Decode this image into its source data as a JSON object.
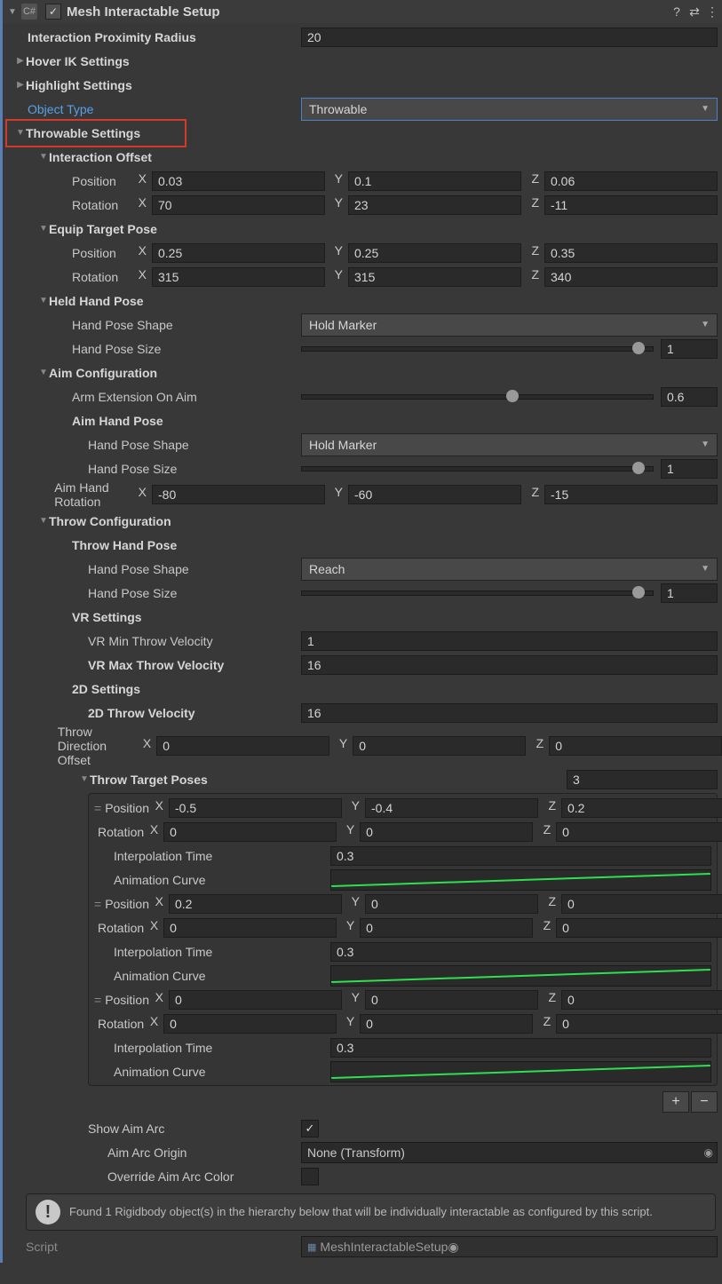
{
  "header": {
    "title": "Mesh Interactable Setup",
    "enabled": true
  },
  "proximity": {
    "label": "Interaction Proximity Radius",
    "value": "20"
  },
  "hoverIK": {
    "label": "Hover IK Settings"
  },
  "highlight": {
    "label": "Highlight Settings"
  },
  "objectType": {
    "label": "Object Type",
    "value": "Throwable"
  },
  "throwable": {
    "header": "Throwable Settings"
  },
  "interactionOffset": {
    "header": "Interaction Offset",
    "position": {
      "label": "Position",
      "x": "0.03",
      "y": "0.1",
      "z": "0.06"
    },
    "rotation": {
      "label": "Rotation",
      "x": "70",
      "y": "23",
      "z": "-11"
    }
  },
  "equipTarget": {
    "header": "Equip Target Pose",
    "position": {
      "label": "Position",
      "x": "0.25",
      "y": "0.25",
      "z": "0.35"
    },
    "rotation": {
      "label": "Rotation",
      "x": "315",
      "y": "315",
      "z": "340"
    }
  },
  "heldHand": {
    "header": "Held Hand Pose",
    "shape": {
      "label": "Hand Pose Shape",
      "value": "Hold Marker"
    },
    "size": {
      "label": "Hand Pose Size",
      "value": "1",
      "pct": 96
    }
  },
  "aim": {
    "header": "Aim Configuration",
    "armExt": {
      "label": "Arm Extension On Aim",
      "value": "0.6",
      "pct": 60
    },
    "poseHeader": "Aim Hand Pose",
    "shape": {
      "label": "Hand Pose Shape",
      "value": "Hold Marker"
    },
    "size": {
      "label": "Hand Pose Size",
      "value": "1",
      "pct": 96
    },
    "rot": {
      "label": "Aim Hand Rotation",
      "x": "-80",
      "y": "-60",
      "z": "-15"
    }
  },
  "throw": {
    "header": "Throw Configuration",
    "poseHeader": "Throw Hand Pose",
    "shape": {
      "label": "Hand Pose Shape",
      "value": "Reach"
    },
    "size": {
      "label": "Hand Pose Size",
      "value": "1",
      "pct": 96
    },
    "vrHeader": "VR Settings",
    "vrMin": {
      "label": "VR Min Throw Velocity",
      "value": "1"
    },
    "vrMax": {
      "label": "VR Max Throw Velocity",
      "value": "16"
    },
    "d2Header": "2D Settings",
    "d2Vel": {
      "label": "2D Throw Velocity",
      "value": "16"
    },
    "dirOff": {
      "label": "Throw Direction Offset",
      "x": "0",
      "y": "0",
      "z": "0"
    },
    "targetsHeader": "Throw Target Poses",
    "targetsCount": "3",
    "targets": [
      {
        "pos": {
          "x": "-0.5",
          "y": "-0.4",
          "z": "0.2"
        },
        "rot": {
          "x": "0",
          "y": "0",
          "z": "0"
        },
        "interp": "0.3"
      },
      {
        "pos": {
          "x": "0.2",
          "y": "0",
          "z": "0"
        },
        "rot": {
          "x": "0",
          "y": "0",
          "z": "0"
        },
        "interp": "0.3"
      },
      {
        "pos": {
          "x": "0",
          "y": "0",
          "z": "0"
        },
        "rot": {
          "x": "0",
          "y": "0",
          "z": "0"
        },
        "interp": "0.3"
      }
    ],
    "posLabel": "Position",
    "rotLabel": "Rotation",
    "interpLabel": "Interpolation Time",
    "curveLabel": "Animation Curve"
  },
  "showAimArc": {
    "label": "Show Aim Arc",
    "checked": true
  },
  "aimArcOrigin": {
    "label": "Aim Arc Origin",
    "value": "None (Transform)"
  },
  "overrideColor": {
    "label": "Override Aim Arc Color",
    "checked": false
  },
  "info": "Found 1 Rigidbody object(s) in the hierarchy below that will be individually interactable as configured by this script.",
  "script": {
    "label": "Script",
    "value": "MeshInteractableSetup"
  },
  "axes": {
    "x": "X",
    "y": "Y",
    "z": "Z"
  }
}
